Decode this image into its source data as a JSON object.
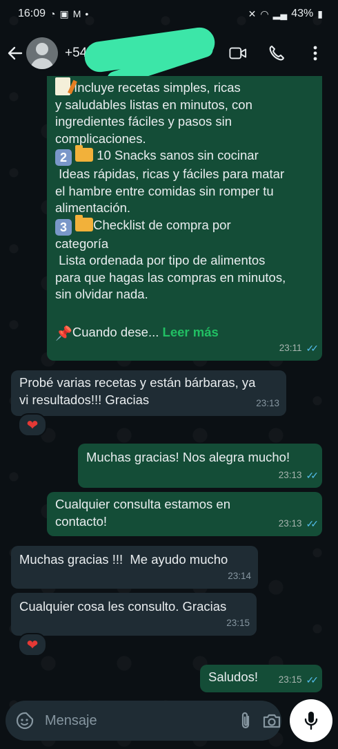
{
  "status_bar": {
    "time": "16:09",
    "battery": "43%"
  },
  "header": {
    "contact_name": "+54 9"
  },
  "messages": [
    {
      "direction": "out",
      "lines": [
        "Incluye recetas simples, ricas",
        "y saludables listas en minutos, con",
        "ingredientes fáciles y pasos sin",
        "complicaciones.",
        "10 Snacks sanos sin cocinar",
        " Ideas rápidas, ricas y fáciles para matar",
        "el hambre entre comidas sin romper tu",
        "alimentación.",
        "Checklist de compra por",
        "categoría",
        " Lista ordenada por tipo de alimentos",
        "para que hagas las compras en minutos,",
        "sin olvidar nada.",
        "Cuando dese..."
      ],
      "badge_2": "2",
      "badge_3": "3",
      "read_more": "Leer más",
      "time": "23:11"
    },
    {
      "direction": "in",
      "text_1": "Probé varias recetas y están bárbaras, ya",
      "text_2": "vi resultados!!! Gracias",
      "time": "23:13",
      "reaction": "❤"
    },
    {
      "direction": "out",
      "text": "Muchas gracias! Nos alegra mucho!",
      "time": "23:13"
    },
    {
      "direction": "out",
      "text_1": "Cualquier consulta estamos en",
      "text_2": "contacto!",
      "time": "23:13"
    },
    {
      "direction": "in",
      "text": "Muchas gracias !!!  Me ayudo mucho",
      "time": "23:14"
    },
    {
      "direction": "in",
      "text": "Cualquier cosa les consulto. Gracias",
      "time": "23:15",
      "reaction": "❤"
    },
    {
      "direction": "out",
      "text": "Saludos!",
      "time": "23:15"
    }
  ],
  "composer": {
    "placeholder": "Mensaje"
  },
  "icons": {
    "back": "arrow-left-icon",
    "video": "video-camera-icon",
    "call": "phone-icon",
    "menu": "kebab-menu-icon",
    "emoji": "sticker-icon",
    "attach": "paperclip-icon",
    "camera": "camera-icon",
    "mic": "microphone-icon"
  },
  "colors": {
    "outgoing_bubble": "#144d37",
    "incoming_bubble": "#1f2c34",
    "read_ticks": "#53bdeb",
    "read_more": "#21c063"
  }
}
